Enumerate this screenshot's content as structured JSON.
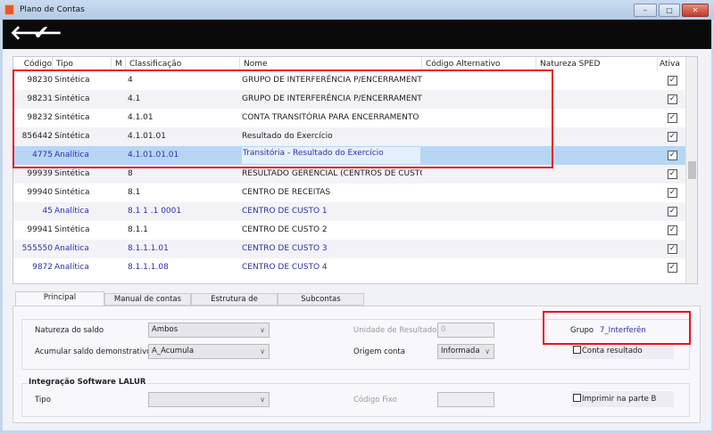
{
  "window": {
    "title": "Plano de Contas",
    "controls": [
      "minimize",
      "maximize",
      "close"
    ]
  },
  "toolbar": {
    "icons": [
      "arrow-left-icon",
      "check-icon"
    ]
  },
  "grid": {
    "columns": [
      "Código",
      "Tipo",
      "M",
      "Classificação",
      "Nome",
      "Código Alternativo",
      "Natureza SPED",
      "Ativa"
    ],
    "rows": [
      {
        "codigo": "98230",
        "tipo": "Sintética",
        "m": "",
        "classificacao": "4",
        "nome": "GRUPO DE INTERFERÊNCIA P/ENCERRAMENTO",
        "ativa": true,
        "blue": false
      },
      {
        "codigo": "98231",
        "tipo": "Sintética",
        "m": "",
        "classificacao": "4.1",
        "nome": "GRUPO DE INTERFERÊNCIA P/ENCERRAMENTO",
        "ativa": true,
        "blue": false
      },
      {
        "codigo": "98232",
        "tipo": "Sintética",
        "m": "",
        "classificacao": "4.1.01",
        "nome": "CONTA TRANSITÓRIA PARA ENCERRAMENTO",
        "ativa": true,
        "blue": false
      },
      {
        "codigo": "856442",
        "tipo": "Sintética",
        "m": "",
        "classificacao": "4.1.01.01",
        "nome": "Resultado do Exercício",
        "ativa": true,
        "blue": false
      },
      {
        "codigo": "4775",
        "tipo": "Analítica",
        "m": "",
        "classificacao": "4.1.01.01.01",
        "nome": "Transitória - Resultado do Exercício",
        "ativa": true,
        "blue": true,
        "selected": true
      },
      {
        "codigo": "99939",
        "tipo": "Sintética",
        "m": "",
        "classificacao": "8",
        "nome": "RESULTADO GERENCIAL (CENTROS DE CUSTO)",
        "ativa": true,
        "blue": false
      },
      {
        "codigo": "99940",
        "tipo": "Sintética",
        "m": "",
        "classificacao": "8.1",
        "nome": "CENTRO DE RECEITAS",
        "ativa": true,
        "blue": false
      },
      {
        "codigo": "45",
        "tipo": "Analítica",
        "m": "",
        "classificacao": "8.1 1 .1 0001",
        "nome": "CENTRO DE CUSTO 1",
        "ativa": true,
        "blue": true
      },
      {
        "codigo": "99941",
        "tipo": "Sintética",
        "m": "",
        "classificacao": "8.1.1",
        "nome": "CENTRO DE CUSTO 2",
        "ativa": true,
        "blue": false
      },
      {
        "codigo": "555550",
        "tipo": "Analítica",
        "m": "",
        "classificacao": "8.1.1.1.01",
        "nome": "CENTRO DE CUSTO 3",
        "ativa": true,
        "blue": true
      },
      {
        "codigo": "9872",
        "tipo": "Analítica",
        "m": "",
        "classificacao": "8.1.1.1.08",
        "nome": "CENTRO DE CUSTO 4",
        "ativa": true,
        "blue": true
      }
    ]
  },
  "tabs": [
    {
      "label": "Principal",
      "active": true
    },
    {
      "label": "Manual de contas"
    },
    {
      "label": "Estrutura de Relatórios"
    },
    {
      "label": "Subcontas"
    }
  ],
  "form": {
    "natureza_label": "Natureza do saldo",
    "natureza_value": "Ambos",
    "acumular_label": "Acumular saldo demonstrativo",
    "acumular_value": "A_Acumula",
    "unidade_label": "Unidade de Resultado",
    "unidade_value": "0",
    "origem_label": "Origem conta",
    "origem_value": "Informada",
    "grupo_label": "Grupo",
    "grupo_value": "7_Interferên",
    "conta_resultado_label": "Conta resultado",
    "conta_resultado_checked": false,
    "lalur_title": "Integração Software LALUR",
    "tipo_label": "Tipo",
    "tipo_value": "",
    "codigo_fixo_label": "Código Fixo",
    "codigo_fixo_value": "",
    "imprimir_label": "Imprimir na parte B",
    "imprimir_checked": false
  },
  "colors": {
    "highlight": "#e8131b",
    "selected_row": "#b7d6f5",
    "analitica_text": "#2e2ea8"
  }
}
